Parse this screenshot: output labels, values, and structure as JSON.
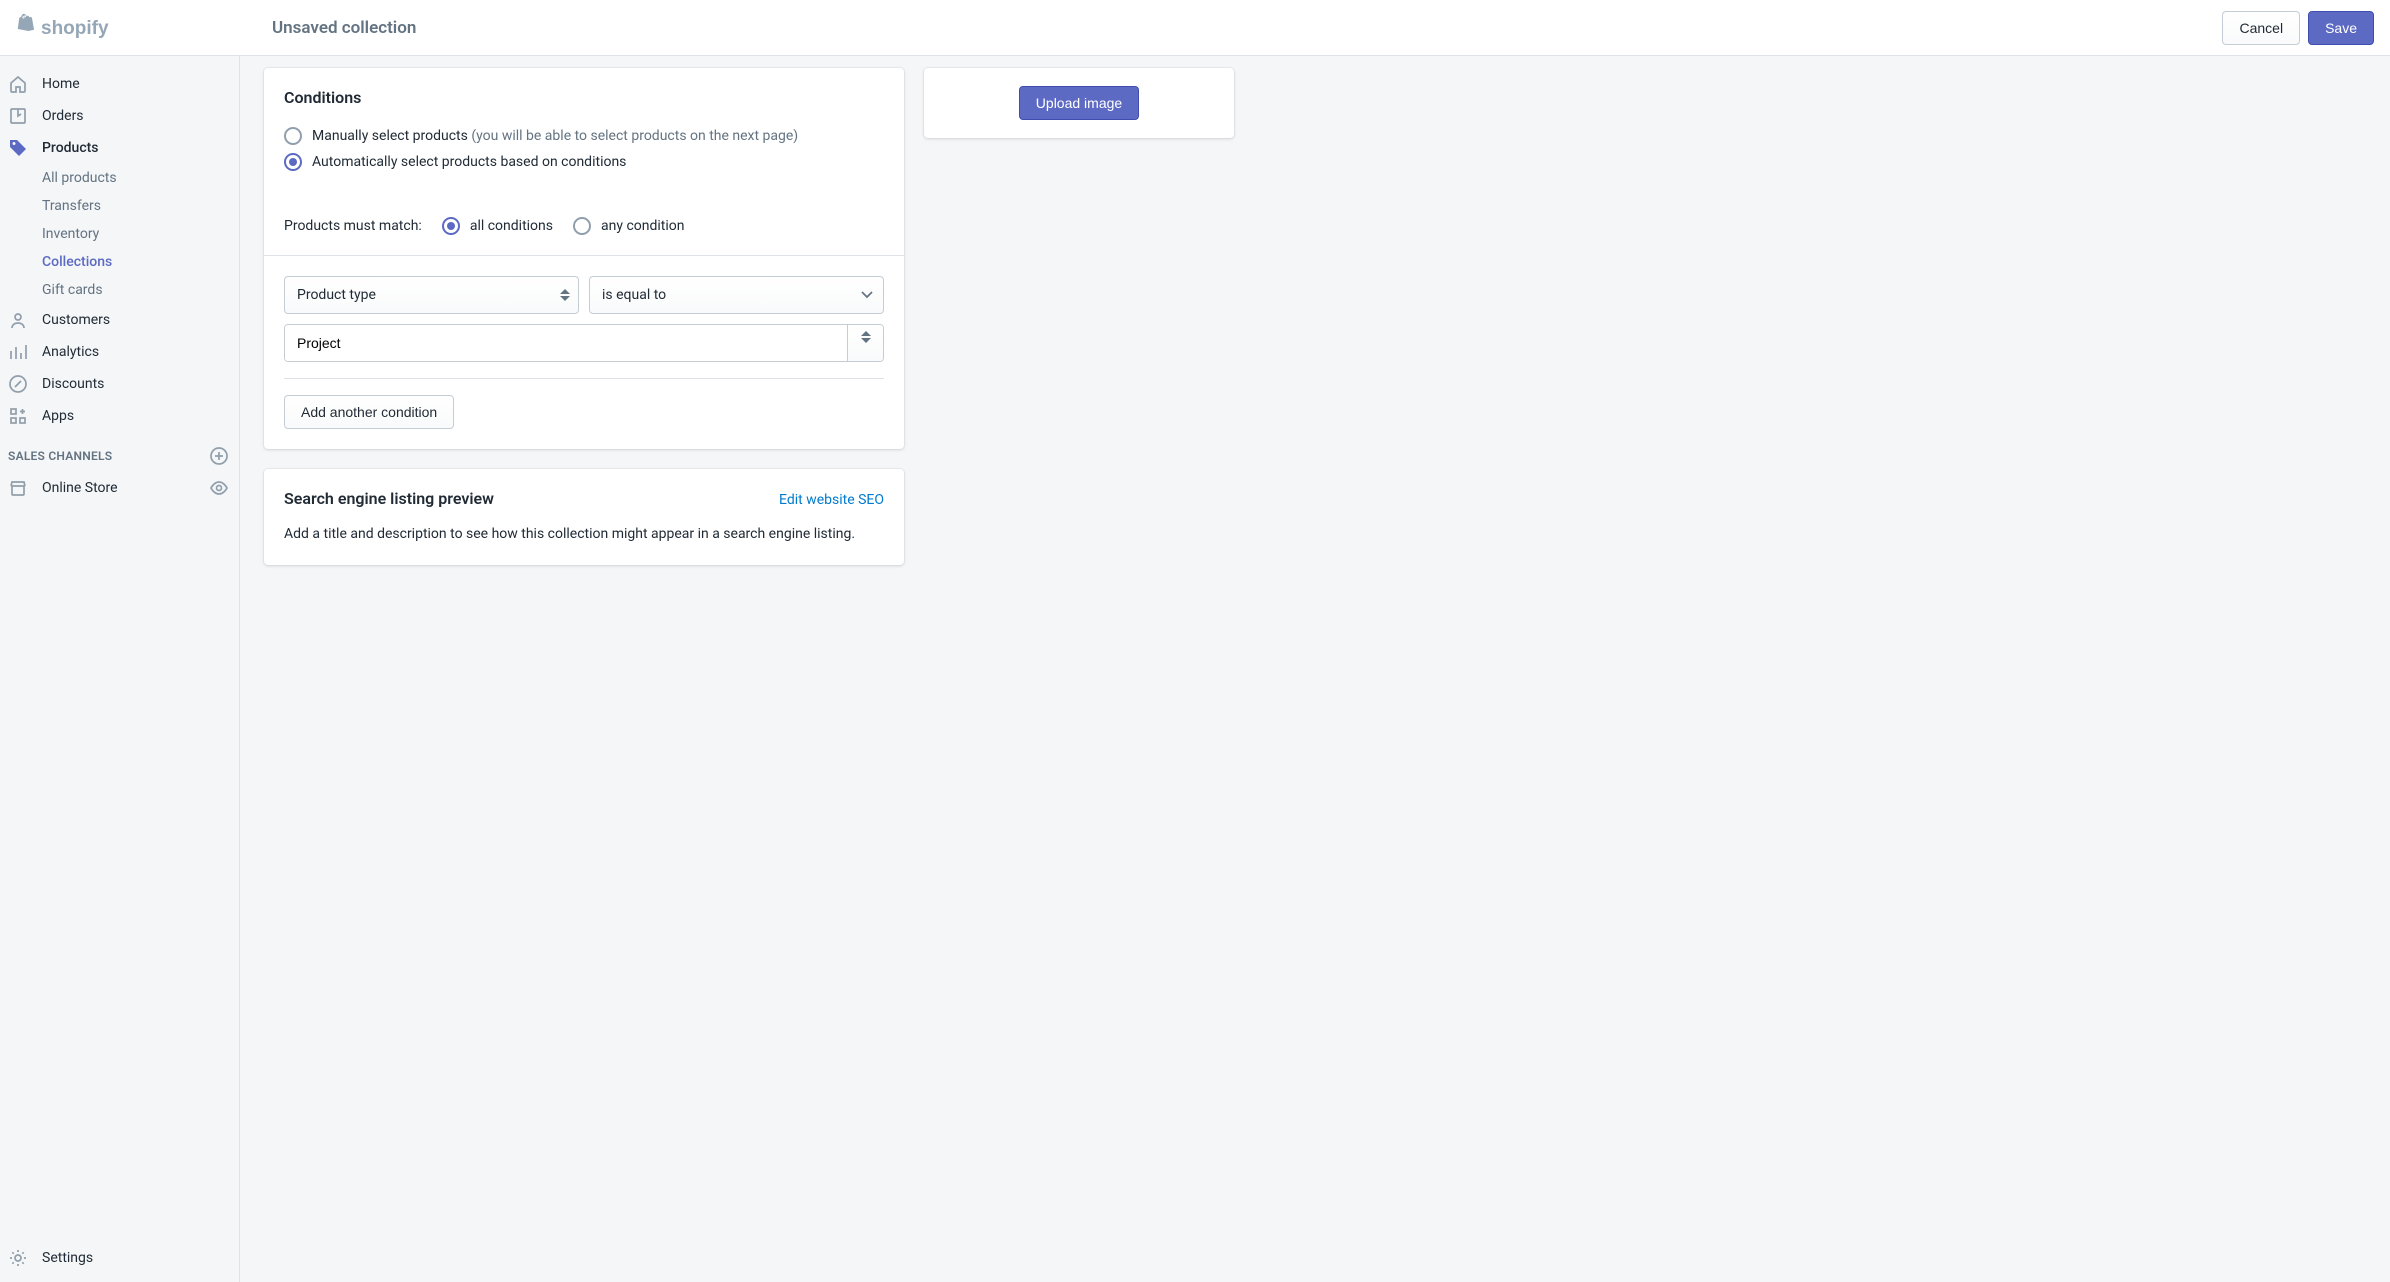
{
  "header": {
    "title": "Unsaved collection",
    "cancel": "Cancel",
    "save": "Save"
  },
  "sidebar": {
    "items": [
      {
        "label": "Home"
      },
      {
        "label": "Orders"
      },
      {
        "label": "Products"
      },
      {
        "label": "Customers"
      },
      {
        "label": "Analytics"
      },
      {
        "label": "Discounts"
      },
      {
        "label": "Apps"
      }
    ],
    "products_sub": [
      {
        "label": "All products"
      },
      {
        "label": "Transfers"
      },
      {
        "label": "Inventory"
      },
      {
        "label": "Collections"
      },
      {
        "label": "Gift cards"
      }
    ],
    "channels_heading": "SALES CHANNELS",
    "online_store": "Online Store",
    "settings": "Settings"
  },
  "conditions": {
    "heading": "Conditions",
    "manual_label": "Manually select products",
    "manual_hint": "(you will be able to select products on the next page)",
    "auto_label": "Automatically select products based on conditions",
    "match_label": "Products must match:",
    "all_label": "all conditions",
    "any_label": "any condition",
    "field_select": "Product type",
    "operator_select": "is equal to",
    "value_input": "Project",
    "add_condition": "Add another condition"
  },
  "seo": {
    "heading": "Search engine listing preview",
    "edit_link": "Edit website SEO",
    "description": "Add a title and description to see how this collection might appear in a search engine listing."
  },
  "image_card": {
    "upload": "Upload image"
  }
}
